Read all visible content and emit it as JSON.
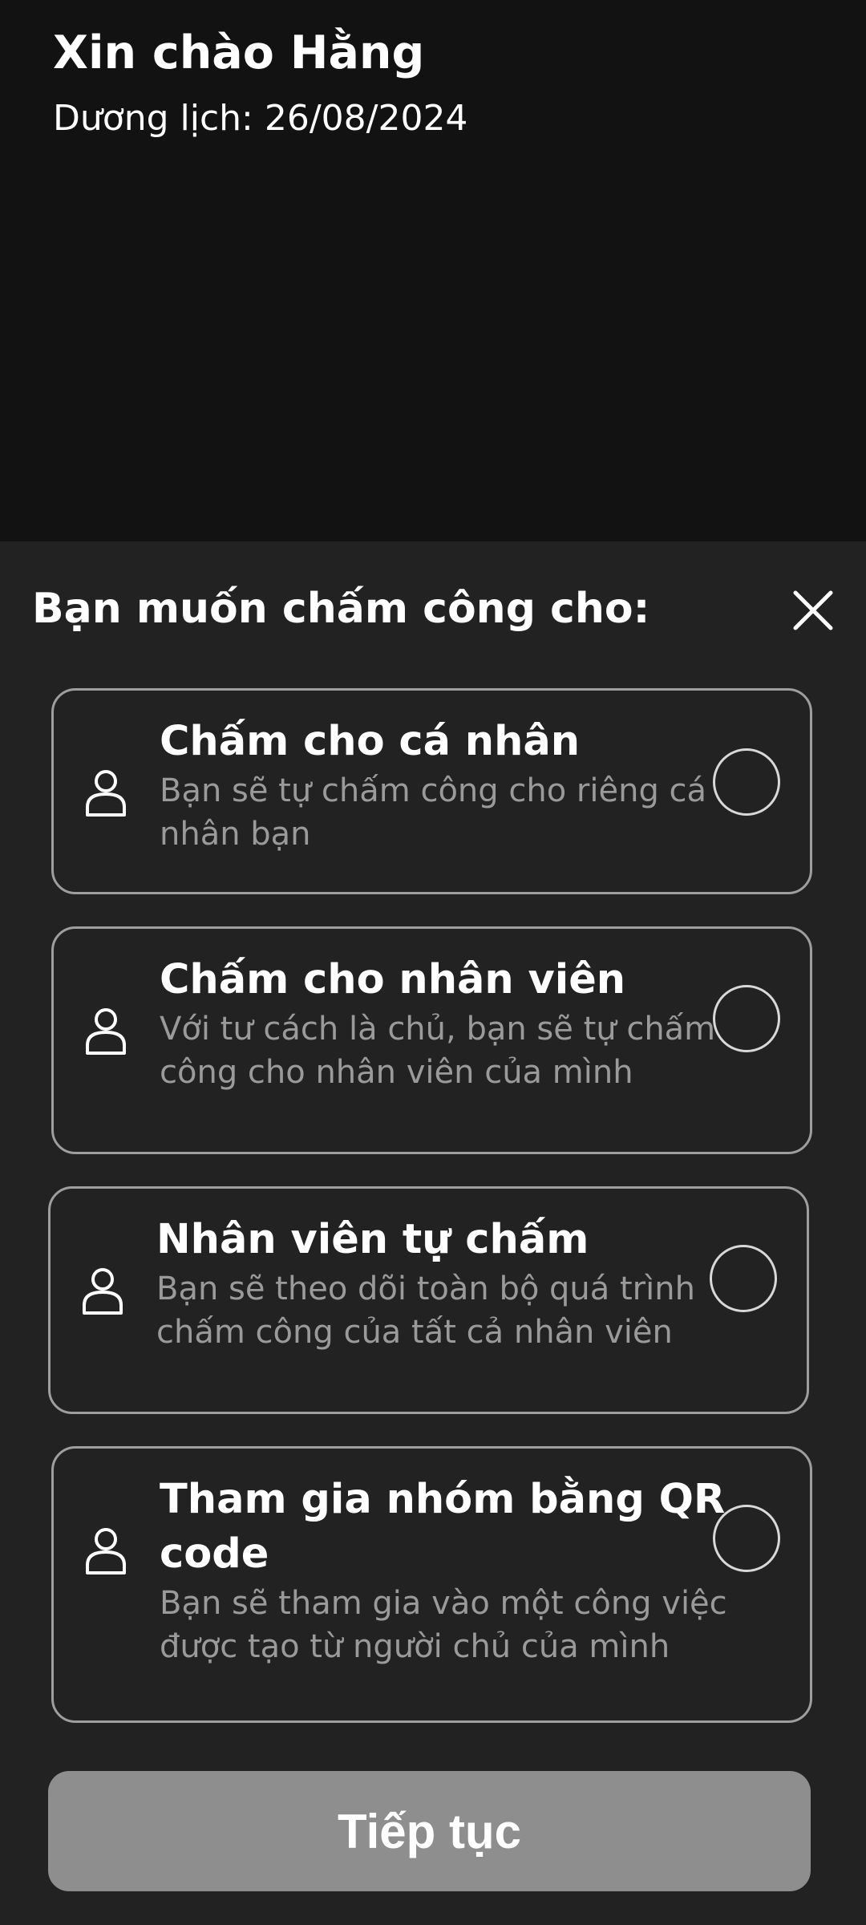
{
  "header": {
    "greeting": "Xin chào Hằng",
    "solar_date": "Dương lịch: 26/08/2024"
  },
  "sheet": {
    "title": "Bạn muốn chấm công cho:",
    "close_icon": "close-icon",
    "options": [
      {
        "icon": "user-icon",
        "title": "Chấm cho cá nhân",
        "description": "Bạn sẽ tự chấm công cho riêng cá nhân bạn",
        "selected": false
      },
      {
        "icon": "user-icon",
        "title": "Chấm cho nhân viên",
        "description": "Với tư cách là chủ, bạn sẽ tự chấm công cho nhân viên của mình",
        "selected": false
      },
      {
        "icon": "user-icon",
        "title": "Nhân viên tự chấm",
        "description": "Bạn sẽ theo dõi toàn bộ quá trình chấm công của tất cả nhân viên",
        "selected": false
      },
      {
        "icon": "user-icon",
        "title": "Tham gia nhóm bằng QR code",
        "description": "Bạn sẽ tham gia vào một công việc được tạo từ người chủ của mình",
        "selected": false
      }
    ],
    "continue_label": "Tiếp tục"
  },
  "colors": {
    "background": "#121212",
    "sheet": "#222223",
    "border": "#9e9e9e",
    "description_text": "#9a9a9a",
    "continue_button_disabled": "#8e8e8e"
  }
}
